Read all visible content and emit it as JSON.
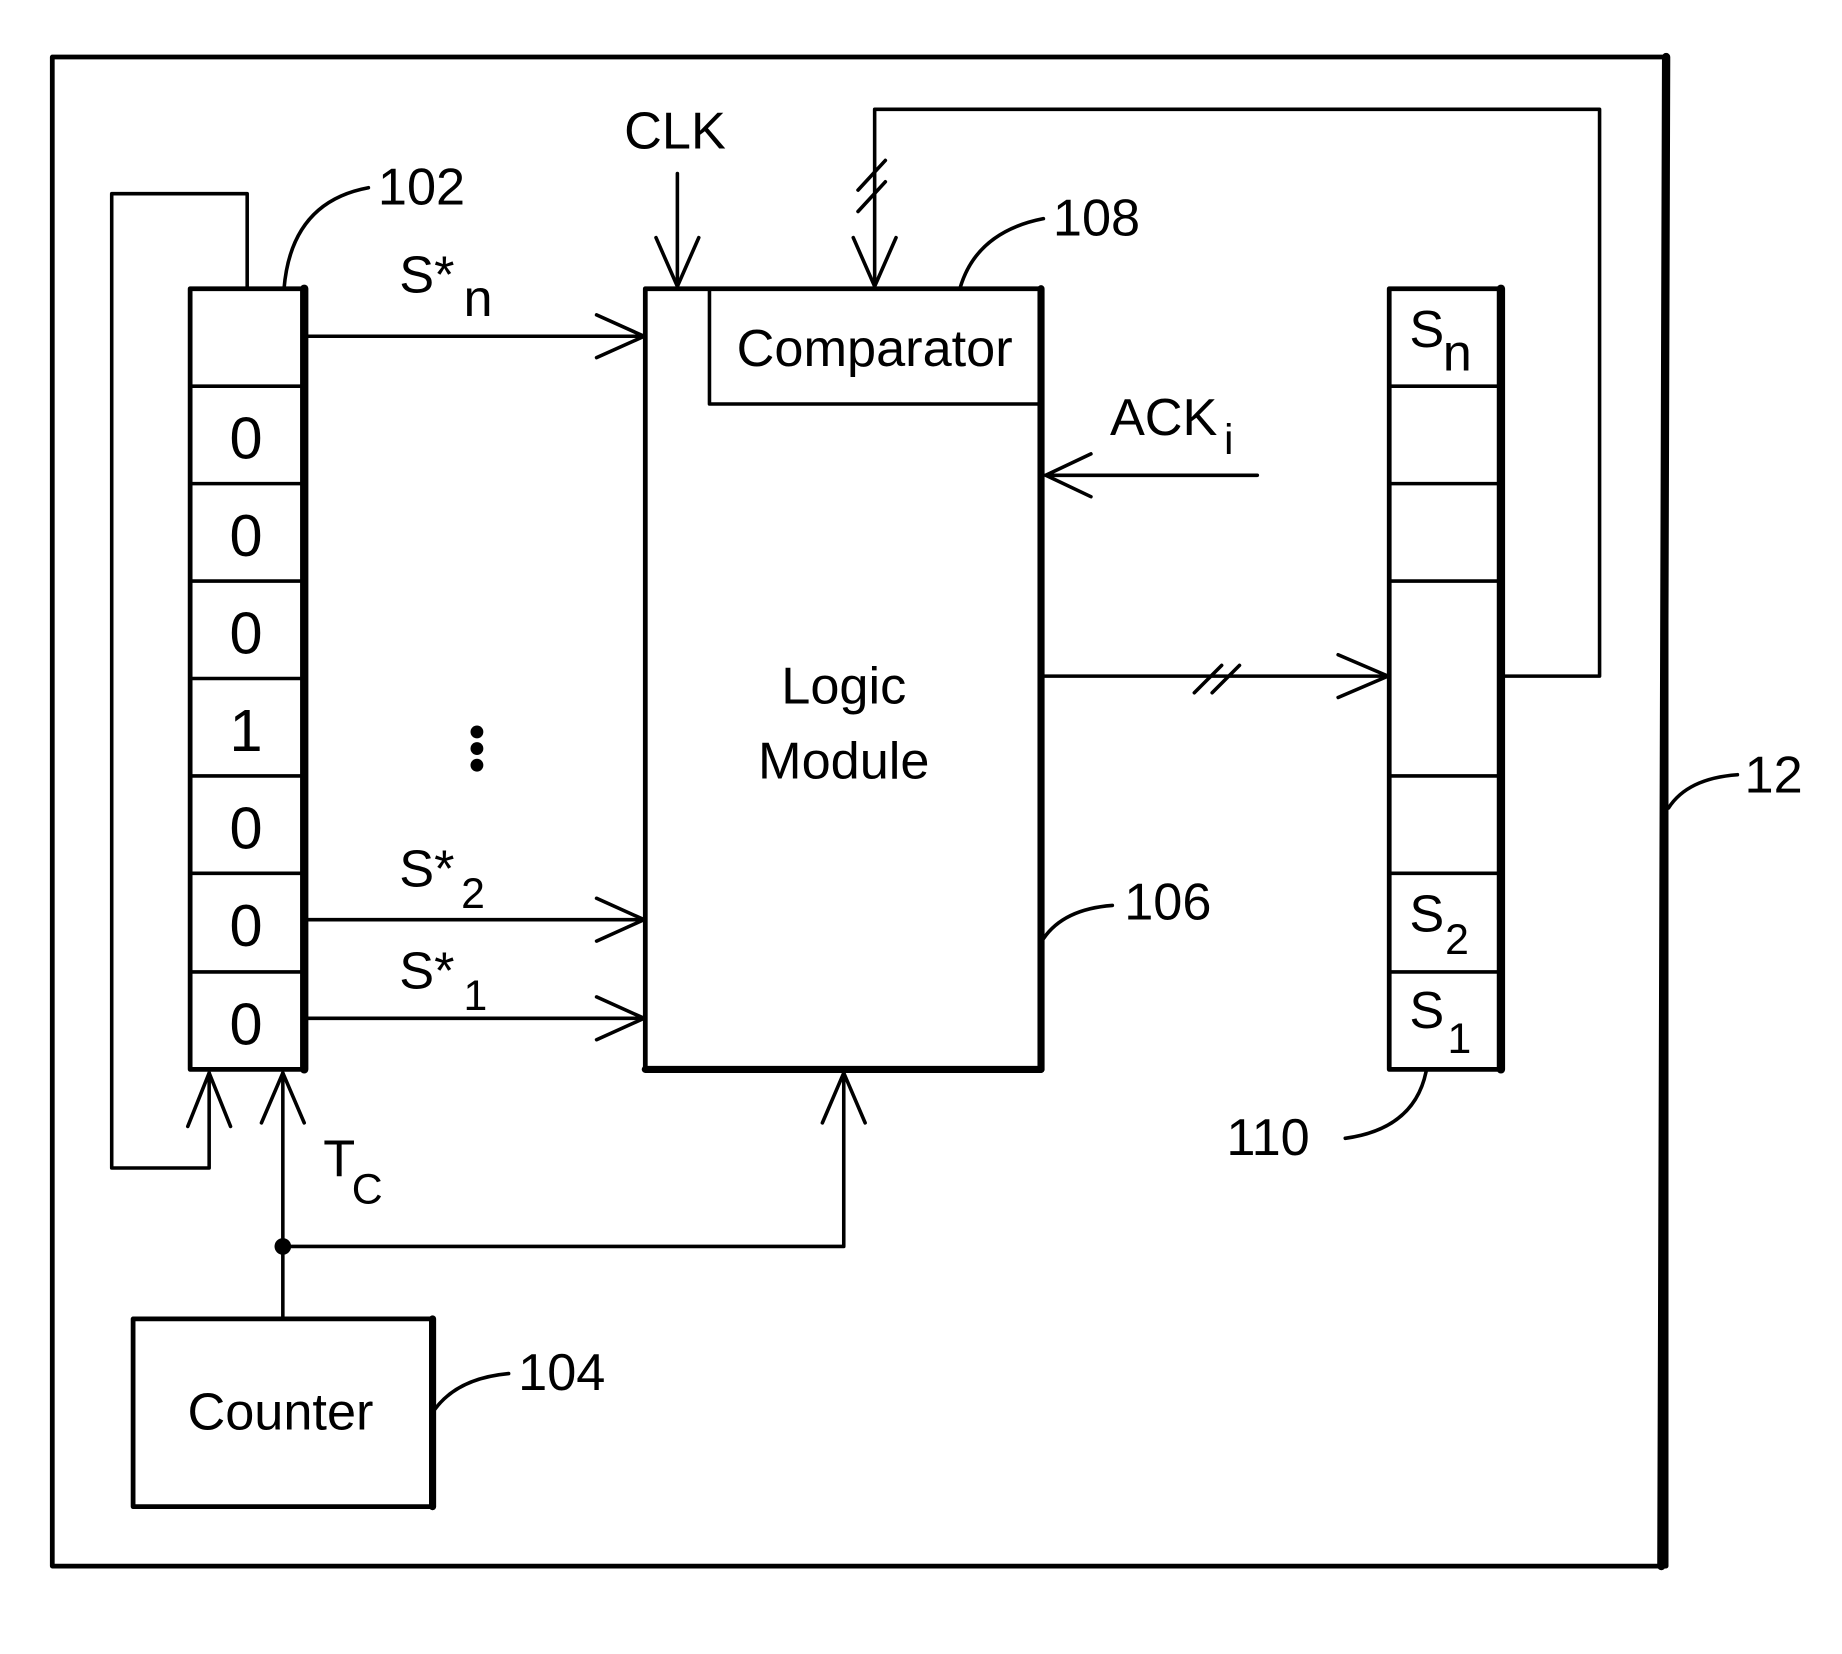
{
  "figure": {
    "container_ref": "12",
    "shift_register": {
      "ref": "102",
      "bits": [
        "",
        "0",
        "0",
        "0",
        "1",
        "0",
        "0",
        "0"
      ]
    },
    "counter": {
      "label": "Counter",
      "ref": "104",
      "signal": "T",
      "signal_sub": "C"
    },
    "logic_module": {
      "label_line1": "Logic",
      "label_line2": "Module",
      "ref": "106"
    },
    "comparator": {
      "label": "Comparator",
      "ref": "108"
    },
    "clock": {
      "label": "CLK"
    },
    "ack": {
      "label": "ACK",
      "sub": "i"
    },
    "inputs": [
      {
        "base": "S*",
        "sub": "n"
      },
      {
        "base": "S*",
        "sub": "2"
      },
      {
        "base": "S*",
        "sub": "1"
      }
    ],
    "ellipsis": "•••",
    "state_register": {
      "ref": "110",
      "cells": [
        {
          "base": "S",
          "sub": "n"
        },
        {
          "base": "",
          "sub": ""
        },
        {
          "base": "",
          "sub": ""
        },
        {
          "base": "",
          "sub": ""
        },
        {
          "base": "",
          "sub": ""
        },
        {
          "base": "",
          "sub": ""
        },
        {
          "base": "S",
          "sub": "2"
        },
        {
          "base": "S",
          "sub": "1"
        }
      ]
    }
  }
}
